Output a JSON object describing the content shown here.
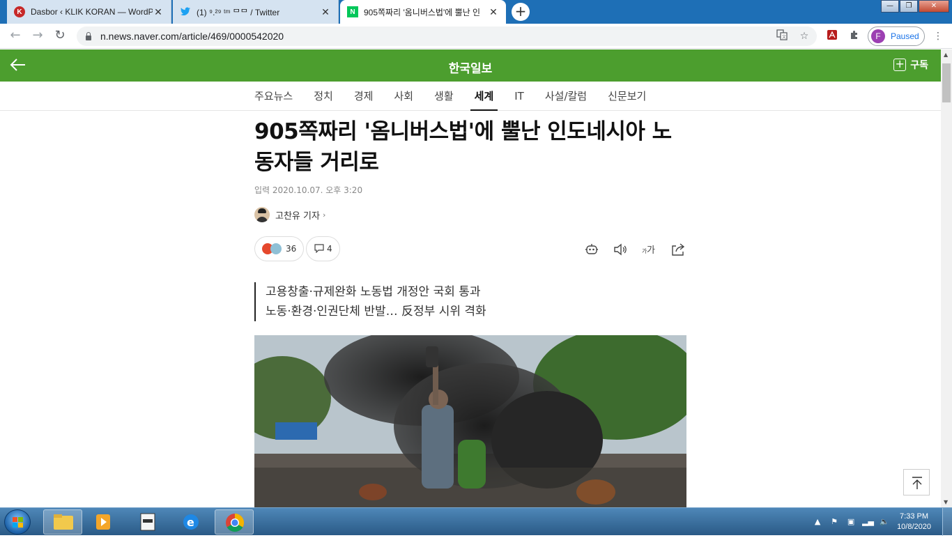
{
  "browser": {
    "tabs": [
      {
        "title": "Dasbor ‹ KLIK KORAN — WordPr",
        "favicon": "klik-koran-icon",
        "active": false
      },
      {
        "title": "(1) ⁹.²⁹ ᵗᵐ ᄆᄆ / Twitter",
        "favicon": "twitter-icon",
        "active": false
      },
      {
        "title": "905쪽짜리 '옴니버스법'에 뿔난 인",
        "favicon": "naver-icon",
        "active": true
      }
    ],
    "url": "n.news.naver.com/article/469/0000542020",
    "profile": {
      "initial": "F",
      "status": "Paused"
    }
  },
  "site": {
    "brand": "한국일보",
    "subscribe_label": "구독",
    "categories": [
      {
        "label": "주요뉴스",
        "selected": false
      },
      {
        "label": "정치",
        "selected": false
      },
      {
        "label": "경제",
        "selected": false
      },
      {
        "label": "사회",
        "selected": false
      },
      {
        "label": "생활",
        "selected": false
      },
      {
        "label": "세계",
        "selected": true
      },
      {
        "label": "IT",
        "selected": false
      },
      {
        "label": "사설/칼럼",
        "selected": false
      },
      {
        "label": "신문보기",
        "selected": false
      }
    ],
    "colors": {
      "brand_green": "#4c9e2e"
    }
  },
  "article": {
    "headline": "905쪽짜리 '옴니버스법'에 뿔난 인도네시아 노동자들 거리로",
    "date": "입력 2020.10.07. 오후 3:20",
    "reporter": "고찬유 기자",
    "reaction_count": "36",
    "comment_count": "4",
    "summary": [
      "고용창출·규제완화 노동법 개정안 국회 통과",
      "노동·환경·인권단체 반발… 反정부 시위 격화"
    ]
  },
  "taskbar": {
    "time": "7:33 PM",
    "date": "10/8/2020"
  }
}
